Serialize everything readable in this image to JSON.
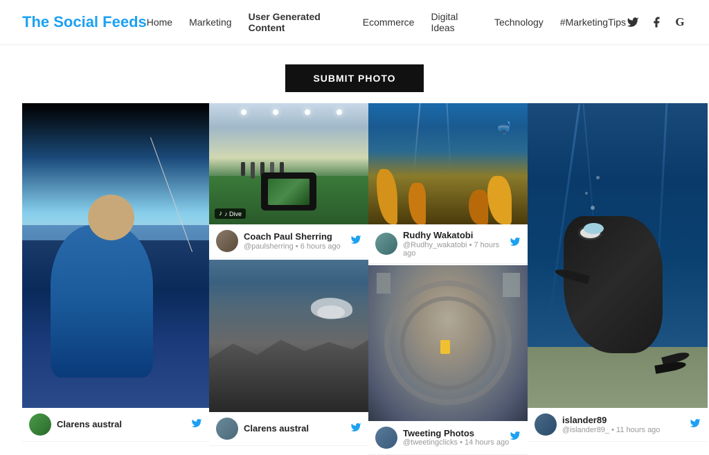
{
  "header": {
    "logo_text": "The ",
    "logo_bold": "Social Feeds",
    "nav_items": [
      {
        "label": "Home",
        "active": false
      },
      {
        "label": "Marketing",
        "active": false
      },
      {
        "label": "User Generated Content",
        "active": true
      },
      {
        "label": "Ecommerce",
        "active": false
      },
      {
        "label": "Digital Ideas",
        "active": false
      },
      {
        "label": "Technology",
        "active": false
      },
      {
        "label": "#MarketingTips",
        "active": false
      }
    ],
    "social_icons": [
      "twitter",
      "facebook",
      "google"
    ]
  },
  "submit_button": "SUBMIT PHOTO",
  "cards": {
    "col1": {
      "user_name": "Clarens austral",
      "user_handle": "",
      "time_ago": ""
    },
    "col2_card1": {
      "user_name": "Coach Paul Sherring",
      "user_handle": "@paulsherring",
      "time_ago": "• 6 hours ago"
    },
    "col2_card2": {
      "user_name": "",
      "user_handle": "",
      "time_ago": ""
    },
    "col3_card1": {
      "user_name": "Rudhy Wakatobi",
      "user_handle": "@Rudhy_wakatobi",
      "time_ago": "• 7 hours ago"
    },
    "col3_card2": {
      "user_name": "Tweeting Photos",
      "user_handle": "@tweetingclicks",
      "time_ago": "• 14 hours ago"
    },
    "col4": {
      "user_name": "islander89",
      "user_handle": "@islander89_",
      "time_ago": "• 11 hours ago"
    }
  },
  "tiktok_label": "♪ Dive",
  "colors": {
    "accent": "#1da1f2",
    "dark": "#111111",
    "nav_active": "#000000"
  }
}
